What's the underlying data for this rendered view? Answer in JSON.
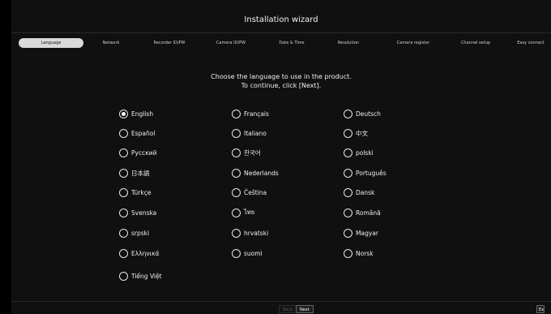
{
  "window": {
    "title": "Installation wizard"
  },
  "steps": [
    {
      "label": "Language",
      "active": true
    },
    {
      "label": "Network"
    },
    {
      "label": "Recorder ID/PW"
    },
    {
      "label": "Camera ID/PW"
    },
    {
      "label": "Date & Time"
    },
    {
      "label": "Resolution"
    },
    {
      "label": "Camera register"
    },
    {
      "label": "Channel setup"
    },
    {
      "label": "Easy connect"
    }
  ],
  "instruction": {
    "line1": "Choose the language to use in the product.",
    "line2": "To continue, click [Next]."
  },
  "languages": [
    {
      "label": "English",
      "selected": true
    },
    {
      "label": "Français"
    },
    {
      "label": "Deutsch"
    },
    {
      "label": "Español"
    },
    {
      "label": "Italiano"
    },
    {
      "label": "中文"
    },
    {
      "label": "Русский"
    },
    {
      "label": "한국어"
    },
    {
      "label": "polski"
    },
    {
      "label": "日本語"
    },
    {
      "label": "Nederlands"
    },
    {
      "label": "Português"
    },
    {
      "label": "Türkçe"
    },
    {
      "label": "Čeština"
    },
    {
      "label": "Dansk"
    },
    {
      "label": "Svenska"
    },
    {
      "label": "ไทย"
    },
    {
      "label": "Română"
    },
    {
      "label": "srpski"
    },
    {
      "label": "hrvatski"
    },
    {
      "label": "Magyar"
    },
    {
      "label": "Ελληνικά"
    },
    {
      "label": "suomi"
    },
    {
      "label": "Norsk"
    },
    {
      "label": "Tiếng Việt"
    }
  ],
  "footer": {
    "back_label": "Back",
    "next_label": "Next",
    "exit_label": "Exit"
  }
}
